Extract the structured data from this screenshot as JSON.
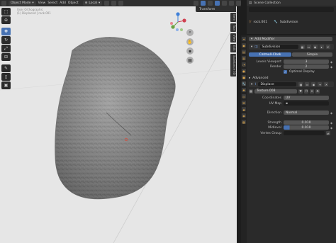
{
  "header": {
    "mode_label": "Object Mode",
    "menus": [
      "View",
      "Select",
      "Add",
      "Object"
    ],
    "orientation_label": "Local",
    "overlay_label": "Transform"
  },
  "viewport": {
    "info_line1": "User Orthographic",
    "info_line2": "(1) Displaced | rock.001",
    "side_tabs": [
      "Item",
      "Tool",
      "View",
      "Edit",
      "Substance 3D"
    ],
    "accent_color": "#4772b3",
    "background_color": "#e6e6e6"
  },
  "outliner": {
    "title": "Scene Collection",
    "object_name": "rock.001",
    "modifier_label": "Subdivision"
  },
  "properties": {
    "add_modifier_label": "Add Modifier",
    "subdivision": {
      "name": "Subdivision",
      "method_active": "Catmull-Clark",
      "method_other": "Simple",
      "levels_viewport_label": "Levels Viewport",
      "levels_viewport_value": "3",
      "render_label": "Render",
      "render_value": "2",
      "optimal_display_label": "Optimal Display",
      "advanced_label": "Advanced"
    },
    "displace": {
      "name": "Displace",
      "texture_name": "Texture.008",
      "coordinates_label": "Coordinates",
      "coordinates_value": "UV",
      "uv_map_label": "UV Map",
      "direction_label": "Direction",
      "direction_value": "Normal",
      "strength_label": "Strength",
      "strength_value": "0.010",
      "midlevel_label": "Midlevel",
      "midlevel_value": "0.010",
      "vertex_group_label": "Vertex Group"
    }
  }
}
